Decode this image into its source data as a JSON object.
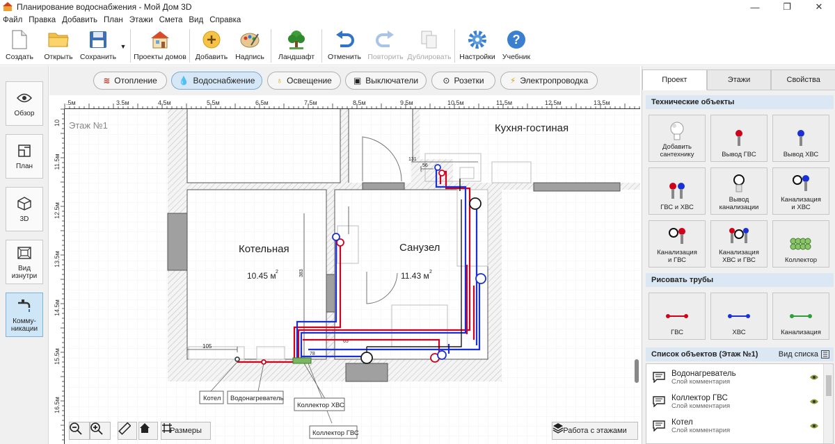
{
  "window": {
    "title": "Планирование водоснабжения - Мой Дом 3D"
  },
  "menu": [
    "Файл",
    "Правка",
    "Добавить",
    "План",
    "Этажи",
    "Смета",
    "Вид",
    "Справка"
  ],
  "toolbar": {
    "create": "Создать",
    "open": "Открыть",
    "save": "Сохранить",
    "house_projects": "Проекты домов",
    "add": "Добавить",
    "label": "Надпись",
    "landscape": "Ландшафт",
    "undo": "Отменить",
    "redo": "Повторить",
    "duplicate": "Дублировать",
    "settings": "Настройки",
    "tutorial": "Учебник"
  },
  "left_nav": {
    "overview": "Обзор",
    "plan": "План",
    "view3d": "3D",
    "inside_l1": "Вид",
    "inside_l2": "изнутри",
    "comm_l1": "Комму-",
    "comm_l2": "никации"
  },
  "mode_tabs": {
    "heating": "Отопление",
    "water": "Водоснабжение",
    "lighting": "Освещение",
    "switches": "Выключатели",
    "sockets": "Розетки",
    "wiring": "Электропроводка"
  },
  "canvas": {
    "floor_label": "Этаж №1",
    "ruler_x": [
      ".5м",
      "3.5м",
      "4.5м",
      "5.5м",
      "6.5м",
      "7.5м",
      "8.5м",
      "9.5м",
      "10.5м",
      "11.5м",
      "12.5м",
      "13.5м"
    ],
    "ruler_y": [
      "10",
      "11.5м",
      "12.5м",
      "13.5м",
      "14.5м",
      "15.5м",
      "16.5м"
    ],
    "room_kitchen": "Кухня-гостиная",
    "room_boiler": "Котельная",
    "room_boiler_area": "10.45 м",
    "room_bath": "Санузел",
    "room_bath_area": "11.43 м",
    "sup": "2",
    "dim_105": "105",
    "dim_56": "56",
    "dim_65": "65",
    "dim_78": "78",
    "dim_131": "131",
    "dim_383": "383",
    "callout_boiler": "Котел",
    "callout_heater": "Водонагреватель",
    "callout_cold": "Коллектор ХВС",
    "callout_hot": "Коллектор ГВС",
    "btn_dimensions": "Размеры",
    "btn_floors": "Работа с этажами"
  },
  "right_panel": {
    "tabs": {
      "project": "Проект",
      "floors": "Этажи",
      "props": "Свойства"
    },
    "tech_header": "Технические объекты",
    "add_plumb_l1": "Добавить",
    "add_plumb_l2": "сантехнику",
    "hot_out": "Вывод ГВС",
    "cold_out": "Вывод ХВС",
    "hot_cold": "ГВС и ХВС",
    "sewer_out_l1": "Вывод",
    "sewer_out_l2": "канализации",
    "sewer_cold_l1": "Канализация",
    "sewer_cold_l2": "и ХВС",
    "sewer_hot_l1": "Канализация",
    "sewer_hot_l2": "и ГВС",
    "sewer_both_l1": "Канализация",
    "sewer_both_l2": "ХВС и ГВС",
    "collector": "Коллектор",
    "pipes_header": "Рисовать трубы",
    "pipe_hot": "ГВС",
    "pipe_cold": "ХВС",
    "pipe_sewer": "Канализация",
    "list_header": "Список объектов (Этаж №1)",
    "list_view": "Вид списка",
    "objects": [
      {
        "name": "Водонагреватель",
        "layer": "Слой комментария"
      },
      {
        "name": "Коллектор ГВС",
        "layer": "Слой комментария"
      },
      {
        "name": "Котел",
        "layer": "Слой комментария"
      }
    ]
  },
  "colors": {
    "hot": "#d0021b",
    "cold": "#1a2fd6",
    "sewer": "#2e9e3a",
    "accent": "#cfe6f7"
  }
}
